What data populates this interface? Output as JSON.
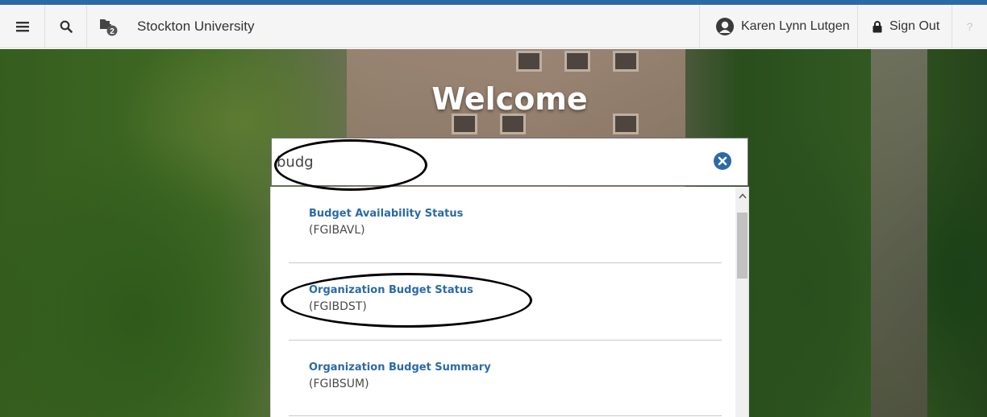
{
  "header": {
    "menu_icon": "hamburger-menu-icon",
    "search_icon": "search-icon",
    "recent_icon": "folder-recent-icon",
    "recent_badge": "2",
    "app_title": "Stockton University",
    "user_name": "Karen Lynn Lutgen",
    "user_icon": "user-avatar-icon",
    "signout_label": "Sign Out",
    "signout_icon": "lock-icon",
    "help_label": "?"
  },
  "hero": {
    "welcome": "Welcome"
  },
  "search": {
    "value": "budg",
    "clear_icon": "close-circle-icon"
  },
  "results": [
    {
      "title": "Budget Availability Status",
      "code": "(FGIBAVL)"
    },
    {
      "title": "Organization Budget Status",
      "code": "(FGIBDST)"
    },
    {
      "title": "Organization Budget Summary",
      "code": "(FGIBSUM)"
    }
  ],
  "colors": {
    "accent": "#2b6aa6",
    "link": "#2b6aa6",
    "header_bg": "#f5f5f5"
  }
}
